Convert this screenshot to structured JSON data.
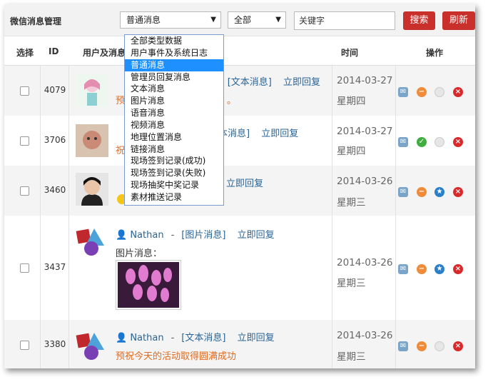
{
  "header": {
    "title": "微信消息管理",
    "type_select": "普通消息",
    "scope_select": "全部",
    "keyword_value": "关键字",
    "search_label": "搜索",
    "refresh_label": "刷新"
  },
  "columns": [
    "选择",
    "ID",
    "用户及消息",
    "时间",
    "操作"
  ],
  "dropdown": {
    "options": [
      "全部类型数据",
      "用户事件及系统日志",
      "普通消息",
      "管理员回复消息",
      "文本消息",
      "图片消息",
      "语音消息",
      "视频消息",
      "地理位置消息",
      "链接消息",
      "现场签到记录(成功)",
      "现场签到记录(失败)",
      "现场抽奖中奖记录",
      "素材推送记录"
    ],
    "selected_index": 2
  },
  "rows": [
    {
      "id": "4079",
      "type_link": "[文本消息]",
      "reply": "立即回复",
      "msg_frag": "预",
      "msg_tail": "。",
      "date": "2014-03-27",
      "week": "星期四"
    },
    {
      "id": "3706",
      "type_link_frag": "本消息]",
      "reply": "立即回复",
      "msg_frag": "祝",
      "date": "2014-03-27",
      "week": "星期四"
    },
    {
      "id": "3460",
      "reply": "立即回复",
      "date": "2014-03-26",
      "week": "星期三"
    },
    {
      "id": "3437",
      "user": "Nathan",
      "dash": "-",
      "type_link": "[图片消息]",
      "reply": "立即回复",
      "msg": "图片消息：",
      "date": "2014-03-26",
      "week": "星期三"
    },
    {
      "id": "3380",
      "user": "Nathan",
      "dash": "-",
      "type_link": "[文本消息]",
      "reply": "立即回复",
      "msg": "预祝今天的活动取得圆满成功",
      "date": "2014-03-26",
      "week": "星期三"
    }
  ],
  "colors": {
    "accent_red": "#c9302c",
    "link_blue": "#2a6496",
    "msg_orange": "#e06b1f",
    "selected_blue": "#1e90ff"
  },
  "icons": [
    "reply-icon",
    "minus-circle-icon",
    "check-circle-icon",
    "star-circle-icon",
    "blank-circle-icon",
    "delete-circle-icon",
    "user-icon"
  ]
}
